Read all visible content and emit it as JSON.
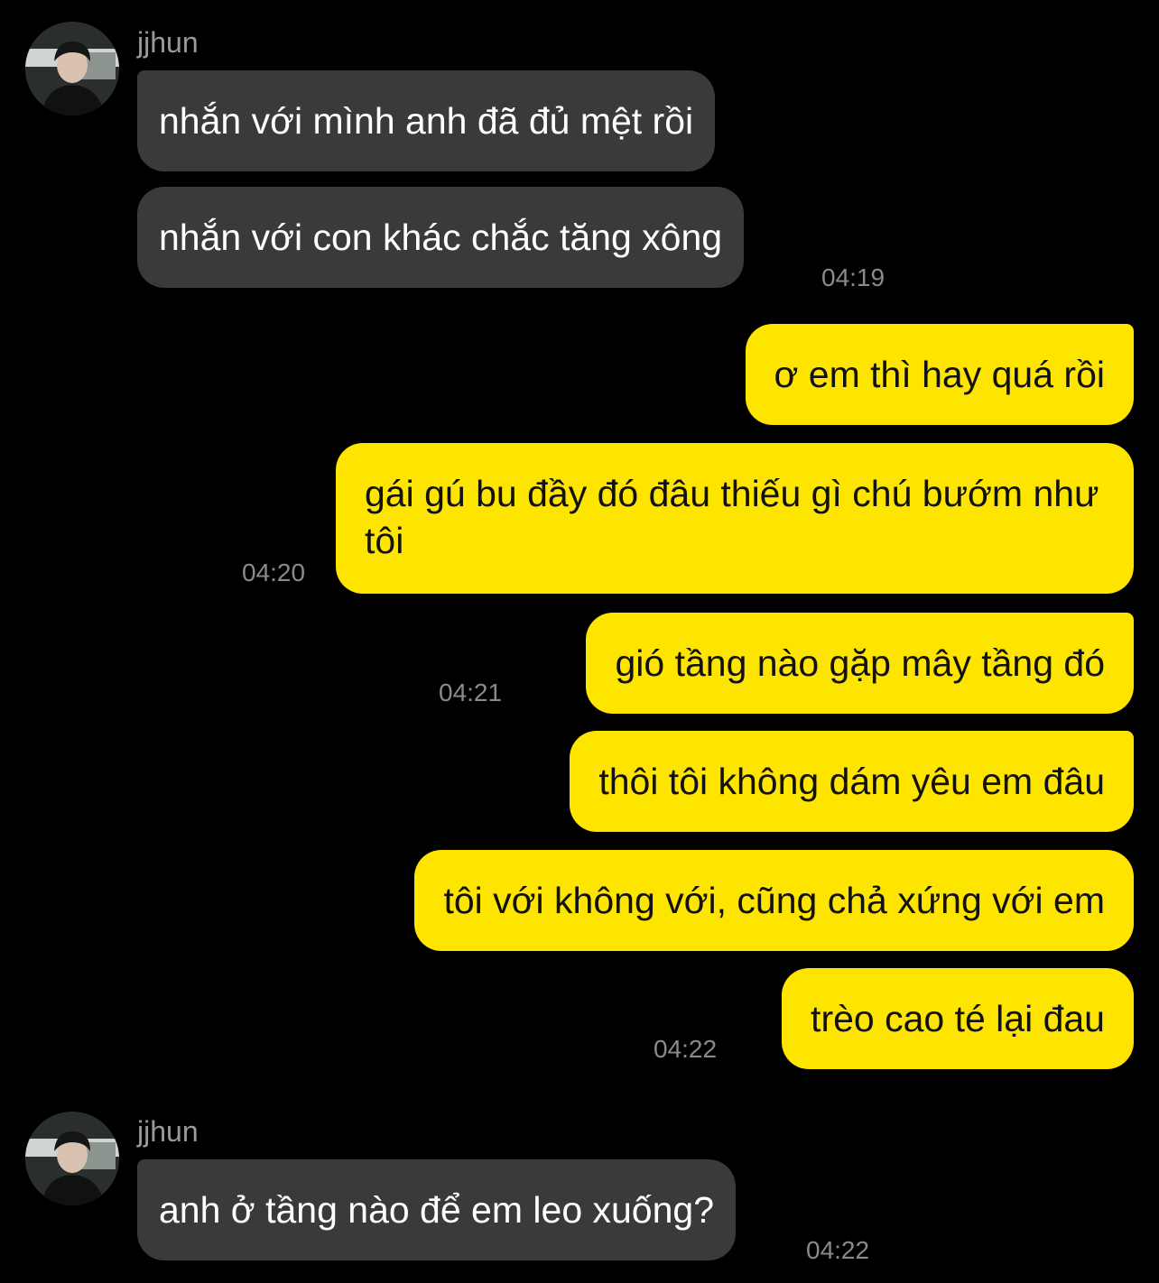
{
  "colors": {
    "background": "#000000",
    "incoming_bubble": "#3a3a3c",
    "outgoing_bubble": "#fde500",
    "timestamp": "#8a8a8a"
  },
  "conversation": {
    "group1": {
      "sender": "jjhun",
      "avatar": "profile-photo",
      "messages": [
        "nhắn với mình anh đã đủ mệt rồi",
        "nhắn với con khác chắc tăng xông"
      ],
      "time": "04:19"
    },
    "outgoing": [
      {
        "text": "ơ em thì hay quá rồi"
      },
      {
        "text": "gái gú bu đầy đó đâu thiếu gì chú bướm như tôi",
        "time": "04:20"
      },
      {
        "text": "gió tầng nào gặp mây tầng đó",
        "time": "04:21"
      },
      {
        "text": "thôi tôi không dám yêu em đâu"
      },
      {
        "text": "tôi với không với, cũng chả xứng với em"
      },
      {
        "text": "trèo cao té lại đau",
        "time": "04:22"
      }
    ],
    "group2": {
      "sender": "jjhun",
      "avatar": "profile-photo",
      "messages": [
        "anh ở tầng nào để em leo xuống?"
      ],
      "time": "04:22"
    }
  }
}
